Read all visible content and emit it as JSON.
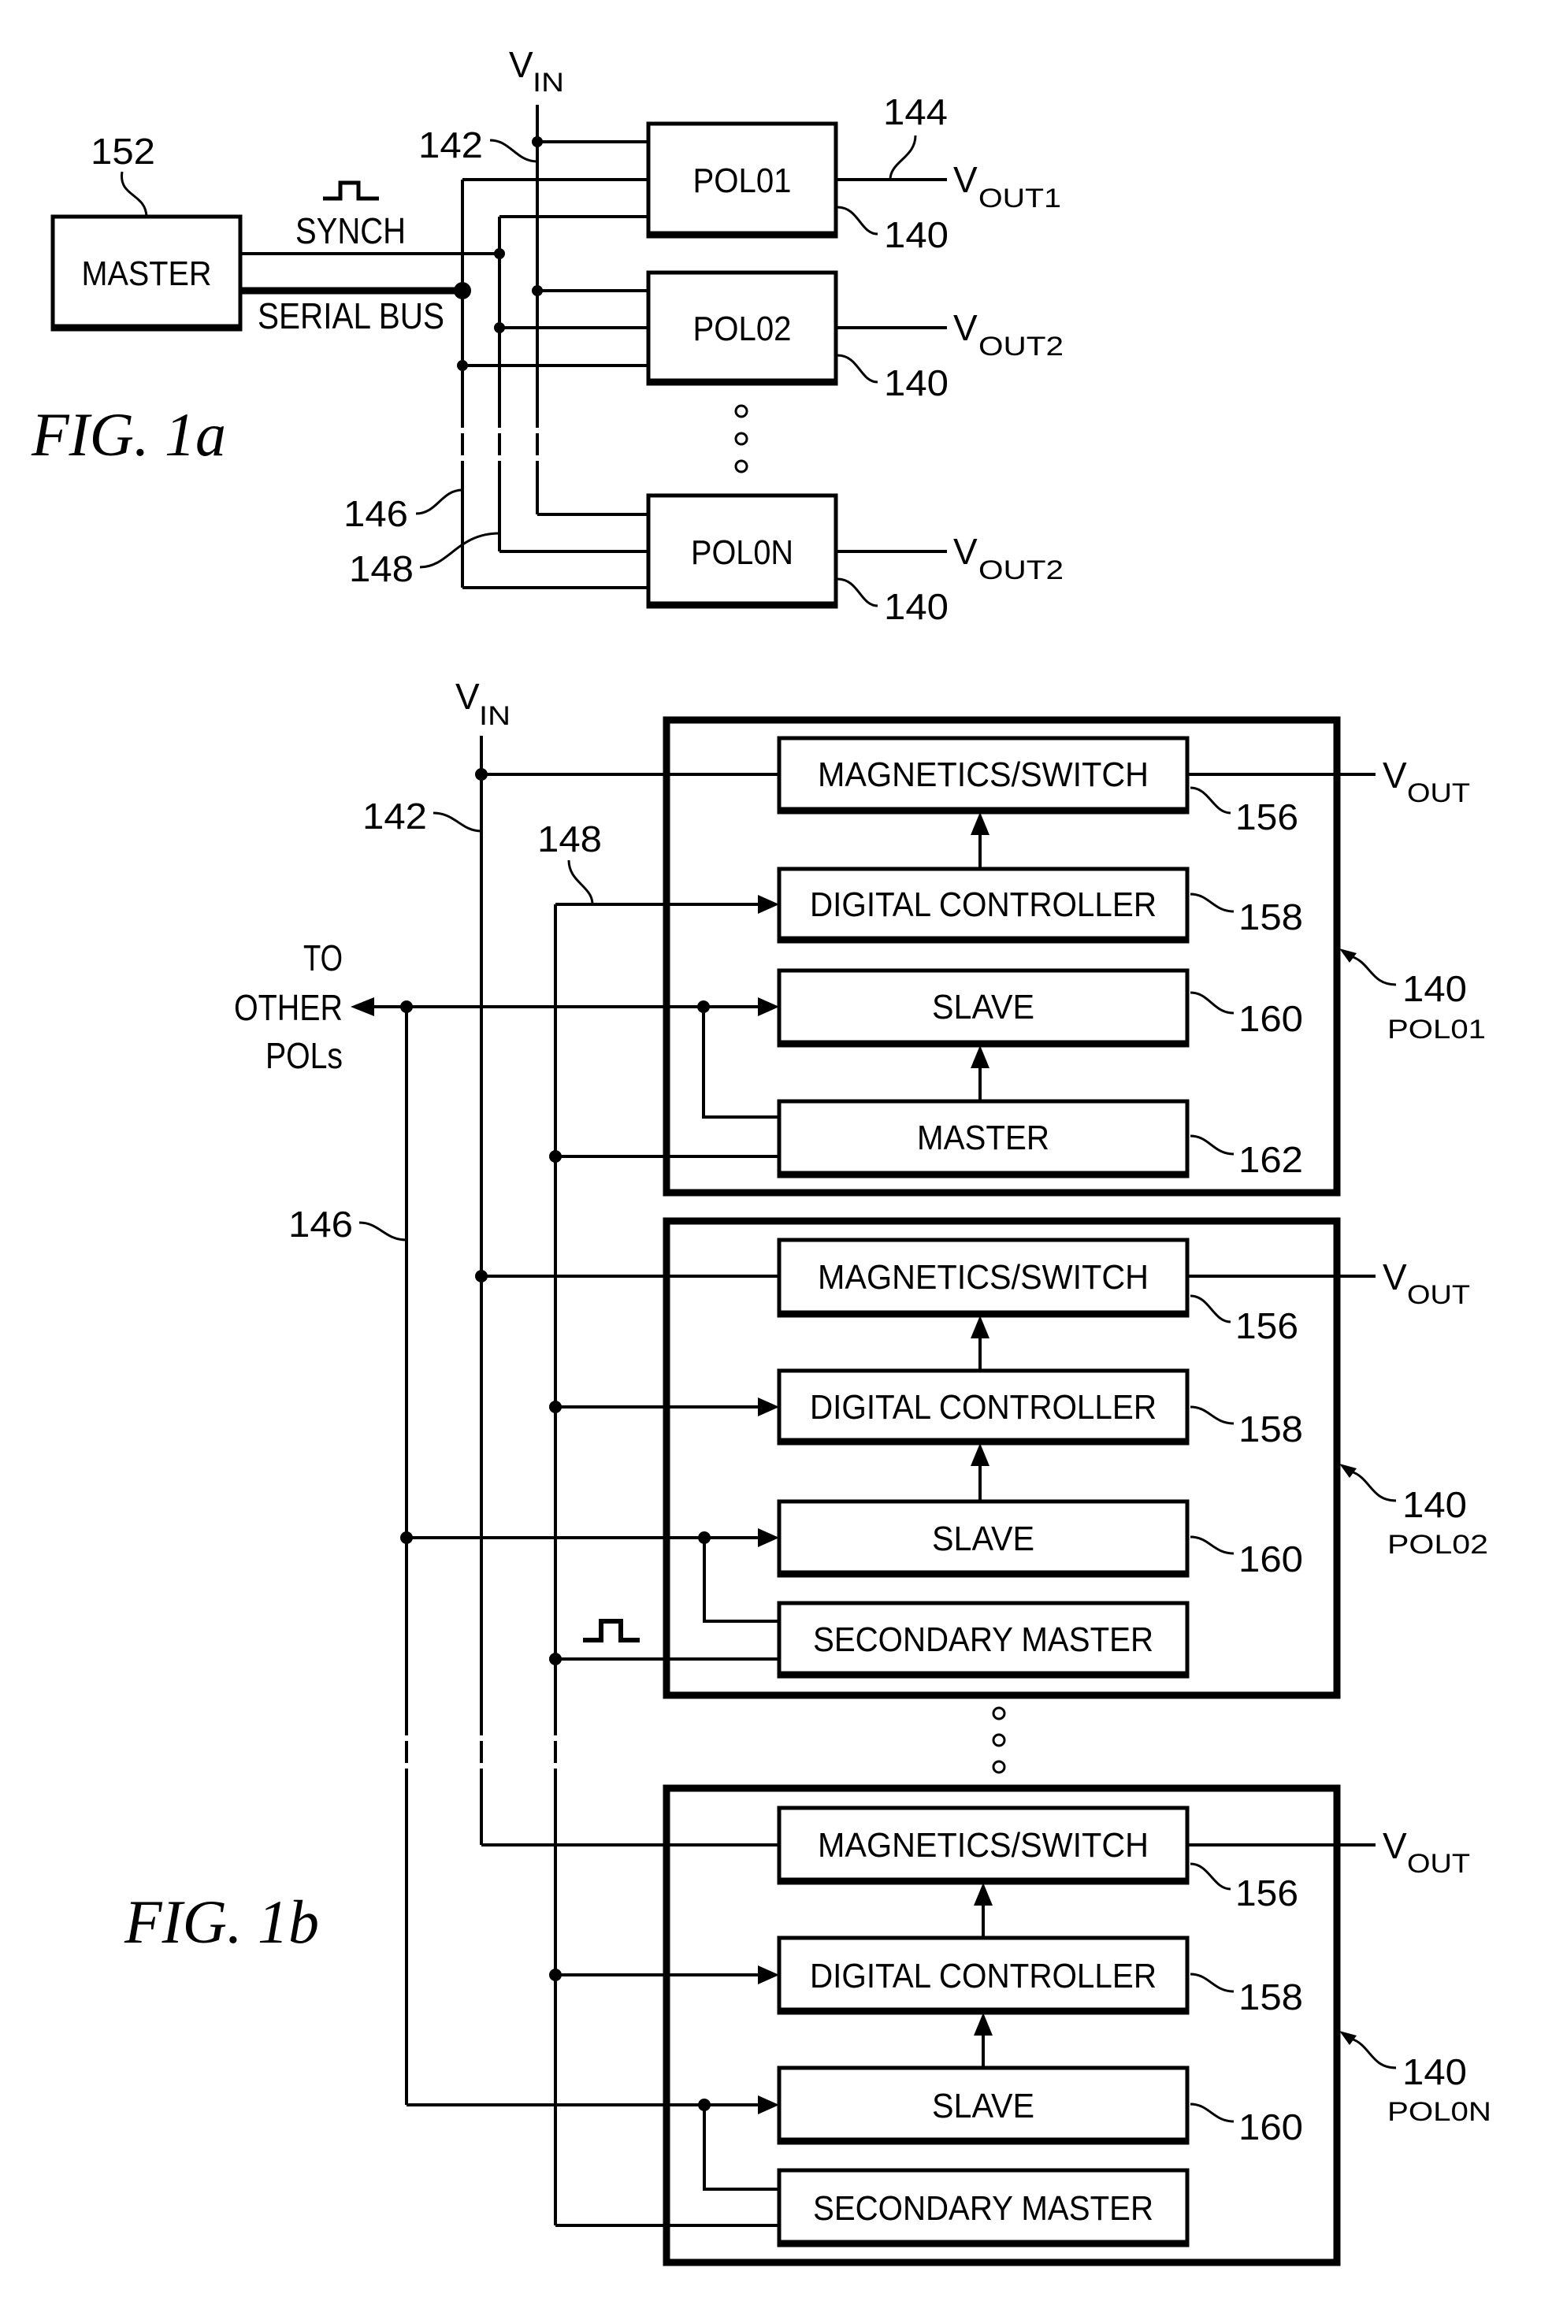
{
  "fig1a": {
    "caption": "FIG. 1a",
    "master": {
      "label": "MASTER",
      "ref": "152"
    },
    "synch_label": "SYNCH",
    "serial_bus_label": "SERIAL BUS",
    "vin": {
      "main": "V",
      "sub": "IN"
    },
    "refs": {
      "vin_line": "142",
      "vout_line": "144",
      "serial_line": "146",
      "synch_line": "148"
    },
    "pols": [
      {
        "label": "POL01",
        "ref": "140",
        "vout_main": "V",
        "vout_sub": "OUT1"
      },
      {
        "label": "POL02",
        "ref": "140",
        "vout_main": "V",
        "vout_sub": "OUT2"
      },
      {
        "label": "POL0N",
        "ref": "140",
        "vout_main": "V",
        "vout_sub": "OUT2"
      }
    ]
  },
  "fig1b": {
    "caption": "FIG. 1b",
    "vin": {
      "main": "V",
      "sub": "IN"
    },
    "refs": {
      "vin_line": "142",
      "synch_line": "148",
      "serial_line": "146"
    },
    "to_other_pols": [
      "TO",
      "OTHER",
      "POLs"
    ],
    "modules": [
      {
        "ref": "140",
        "name": "POL01",
        "vout_main": "V",
        "vout_sub": "OUT",
        "blocks": [
          {
            "label": "MAGNETICS/SWITCH",
            "ref": "156"
          },
          {
            "label": "DIGITAL CONTROLLER",
            "ref": "158"
          },
          {
            "label": "SLAVE",
            "ref": "160"
          },
          {
            "label": "MASTER",
            "ref": "162"
          }
        ]
      },
      {
        "ref": "140",
        "name": "POL02",
        "vout_main": "V",
        "vout_sub": "OUT",
        "blocks": [
          {
            "label": "MAGNETICS/SWITCH",
            "ref": "156"
          },
          {
            "label": "DIGITAL CONTROLLER",
            "ref": "158"
          },
          {
            "label": "SLAVE",
            "ref": "160"
          },
          {
            "label": "SECONDARY MASTER",
            "ref": ""
          }
        ]
      },
      {
        "ref": "140",
        "name": "POL0N",
        "vout_main": "V",
        "vout_sub": "OUT",
        "blocks": [
          {
            "label": "MAGNETICS/SWITCH",
            "ref": "156"
          },
          {
            "label": "DIGITAL CONTROLLER",
            "ref": "158"
          },
          {
            "label": "SLAVE",
            "ref": "160"
          },
          {
            "label": "SECONDARY MASTER",
            "ref": ""
          }
        ]
      }
    ]
  }
}
